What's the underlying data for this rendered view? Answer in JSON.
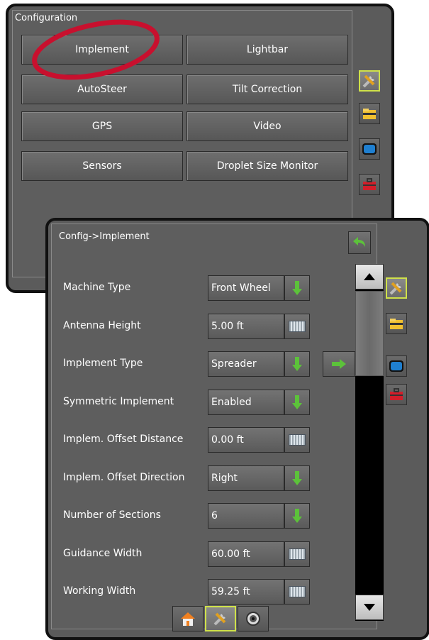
{
  "config_screen": {
    "title": "Configuration",
    "buttons": [
      "Implement",
      "Lightbar",
      "AutoSteer",
      "Tilt Correction",
      "GPS",
      "Video",
      "Sensors",
      "Droplet Size Monitor"
    ],
    "highlight_color": "#c8102e"
  },
  "implement_screen": {
    "title": "Config->Implement",
    "back_icon": "back-arrow-icon",
    "rows": [
      {
        "label": "Machine Type",
        "value": "Front Wheel",
        "control": "dropdown"
      },
      {
        "label": "Antenna Height",
        "value": "5.00 ft",
        "control": "keyboard"
      },
      {
        "label": "Implement Type",
        "value": "Spreader",
        "control": "dropdown",
        "extra": "next-arrow"
      },
      {
        "label": "Symmetric Implement",
        "value": "Enabled",
        "control": "dropdown"
      },
      {
        "label": "Implem. Offset Distance",
        "value": "0.00 ft",
        "control": "keyboard"
      },
      {
        "label": "Implem. Offset Direction",
        "value": "Right",
        "control": "dropdown"
      },
      {
        "label": "Number of Sections",
        "value": "6",
        "control": "dropdown"
      },
      {
        "label": "Guidance Width",
        "value": "60.00 ft",
        "control": "keyboard"
      },
      {
        "label": "Working Width",
        "value": "59.25 ft",
        "control": "keyboard"
      }
    ]
  },
  "side_tabs": [
    "tools-icon",
    "folder-icon",
    "display-icon",
    "toolbox-icon"
  ],
  "bottom_tabs": [
    "home-icon",
    "tools-icon",
    "camera-icon"
  ],
  "colors": {
    "accent": "#cfe14a",
    "arrow_green": "#5cc23a",
    "panel_bg": "#5e5e5e"
  }
}
